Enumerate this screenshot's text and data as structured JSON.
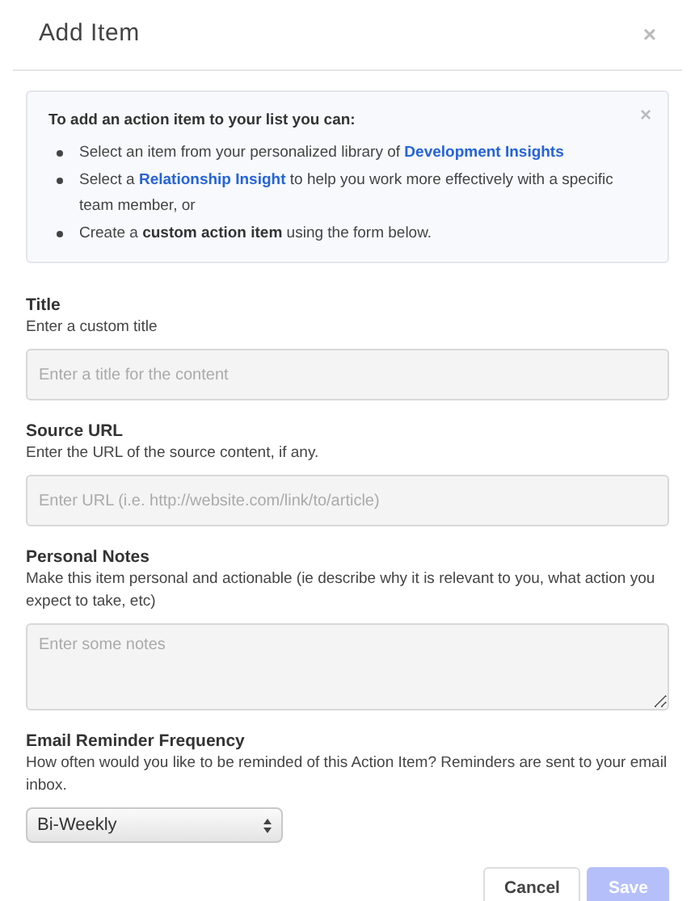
{
  "dialog": {
    "title": "Add Item",
    "close": "×"
  },
  "info": {
    "heading": "To add an action item to your list you can:",
    "close": "×",
    "bullets": [
      [
        {
          "kind": "text",
          "text": "Select an item from your personalized library of "
        },
        {
          "kind": "link",
          "text": "Development Insights"
        }
      ],
      [
        {
          "kind": "text",
          "text": "Select a "
        },
        {
          "kind": "link",
          "text": "Relationship Insight"
        },
        {
          "kind": "text",
          "text": " to help you work more effectively with a specific team member, or"
        }
      ],
      [
        {
          "kind": "text",
          "text": "Create a "
        },
        {
          "kind": "bold",
          "text": "custom action item"
        },
        {
          "kind": "text",
          "text": " using the form below."
        }
      ]
    ]
  },
  "fields": [
    {
      "kind": "text",
      "label": "Title",
      "help": "Enter a custom title",
      "placeholder": "Enter a title for the content"
    },
    {
      "kind": "text",
      "label": "Source URL",
      "help": "Enter the URL of the source content, if any.",
      "placeholder": "Enter URL (i.e. http://website.com/link/to/article)"
    },
    {
      "kind": "textarea",
      "label": "Personal Notes",
      "help": "Make this item personal and actionable (ie describe why it is relevant to you, what action you expect to take, etc)",
      "placeholder": "Enter some notes"
    },
    {
      "kind": "select",
      "label": "Email Reminder Frequency",
      "help": "How often would you like to be reminded of this Action Item? Reminders are sent to your email inbox.",
      "value": "Bi-Weekly"
    }
  ],
  "buttons": [
    {
      "label": "Cancel",
      "kind": "secondary",
      "disabled": false
    },
    {
      "label": "Save",
      "kind": "primary",
      "disabled": true
    }
  ]
}
